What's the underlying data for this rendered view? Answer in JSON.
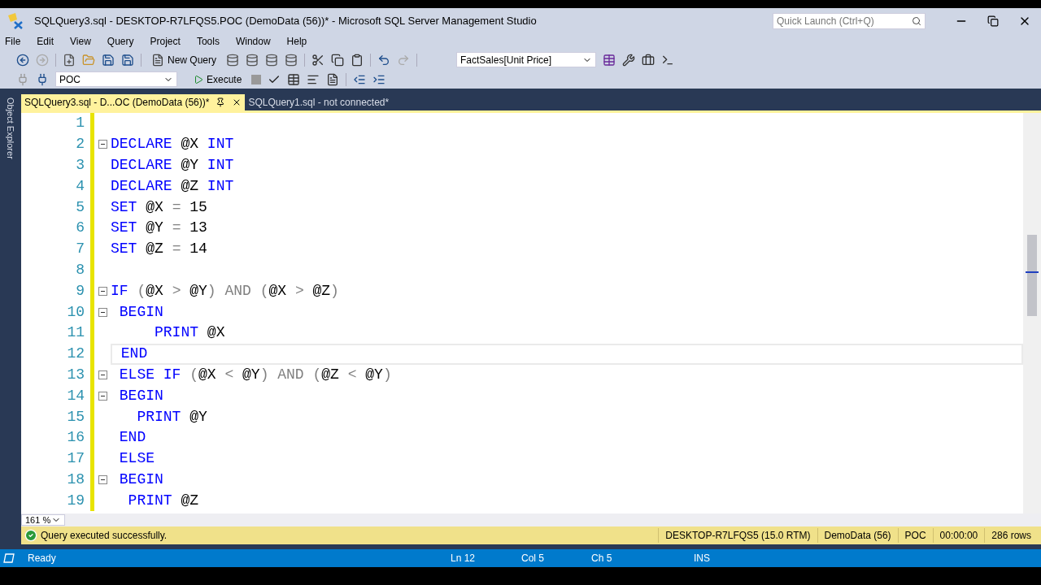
{
  "window": {
    "title": "SQLQuery3.sql - DESKTOP-R7LFQS5.POC (DemoData (56))* - Microsoft SQL Server Management Studio"
  },
  "quick_launch": {
    "placeholder": "Quick Launch (Ctrl+Q)"
  },
  "menu": [
    "File",
    "Edit",
    "View",
    "Query",
    "Project",
    "Tools",
    "Window",
    "Help"
  ],
  "toolbar": {
    "new_query": "New Query",
    "combo": "FactSales[Unit Price]",
    "database": "POC",
    "execute": "Execute"
  },
  "side_panel": {
    "title": "Object Explorer"
  },
  "tabs": [
    {
      "label": "SQLQuery3.sql - D...OC (DemoData (56))*",
      "selected": true
    },
    {
      "label": "SQLQuery1.sql - not connected*",
      "selected": false
    }
  ],
  "editor": {
    "lines": [
      {
        "number": "1",
        "collapsible": false,
        "current": false
      },
      {
        "number": "2",
        "collapsible": true,
        "current": false,
        "tokens": [
          {
            "kind": "keyword",
            "text": "DECLARE"
          },
          {
            "kind": "plain",
            "text": " @X "
          },
          {
            "kind": "keyword",
            "text": "INT"
          }
        ]
      },
      {
        "number": "3",
        "collapsible": false,
        "current": false,
        "tokens": [
          {
            "kind": "keyword",
            "text": "DECLARE"
          },
          {
            "kind": "plain",
            "text": " @Y "
          },
          {
            "kind": "keyword",
            "text": "INT"
          }
        ]
      },
      {
        "number": "4",
        "collapsible": false,
        "current": false,
        "tokens": [
          {
            "kind": "keyword",
            "text": "DECLARE"
          },
          {
            "kind": "plain",
            "text": " @Z "
          },
          {
            "kind": "keyword",
            "text": "INT"
          }
        ]
      },
      {
        "number": "5",
        "collapsible": false,
        "current": false,
        "tokens": [
          {
            "kind": "keyword",
            "text": "SET"
          },
          {
            "kind": "plain",
            "text": " @X "
          },
          {
            "kind": "operator",
            "text": "="
          },
          {
            "kind": "plain",
            "text": " 15"
          }
        ]
      },
      {
        "number": "6",
        "collapsible": false,
        "current": false,
        "tokens": [
          {
            "kind": "keyword",
            "text": "SET"
          },
          {
            "kind": "plain",
            "text": " @Y "
          },
          {
            "kind": "operator",
            "text": "="
          },
          {
            "kind": "plain",
            "text": " 13"
          }
        ]
      },
      {
        "number": "7",
        "collapsible": false,
        "current": false,
        "tokens": [
          {
            "kind": "keyword",
            "text": "SET"
          },
          {
            "kind": "plain",
            "text": " @Z "
          },
          {
            "kind": "operator",
            "text": "="
          },
          {
            "kind": "plain",
            "text": " 14"
          }
        ]
      },
      {
        "number": "8",
        "collapsible": false,
        "current": false
      },
      {
        "number": "9",
        "collapsible": true,
        "current": false,
        "tokens": [
          {
            "kind": "keyword",
            "text": "IF"
          },
          {
            "kind": "operator",
            "text": " ("
          },
          {
            "kind": "plain",
            "text": "@X "
          },
          {
            "kind": "operator",
            "text": ">"
          },
          {
            "kind": "plain",
            "text": " @Y"
          },
          {
            "kind": "operator",
            "text": ") AND ("
          },
          {
            "kind": "plain",
            "text": "@X "
          },
          {
            "kind": "operator",
            "text": ">"
          },
          {
            "kind": "plain",
            "text": " @Z"
          },
          {
            "kind": "operator",
            "text": ")"
          }
        ]
      },
      {
        "number": "10",
        "collapsible": true,
        "current": false,
        "tokens": [
          {
            "kind": "keyword",
            "text": " BEGIN"
          }
        ]
      },
      {
        "number": "11",
        "collapsible": false,
        "current": false,
        "tokens": [
          {
            "kind": "keyword",
            "text": "     PRINT"
          },
          {
            "kind": "plain",
            "text": " @X"
          }
        ]
      },
      {
        "number": "12",
        "collapsible": false,
        "current": true,
        "tokens": [
          {
            "kind": "keyword",
            "text": " END"
          }
        ]
      },
      {
        "number": "13",
        "collapsible": true,
        "current": false,
        "tokens": [
          {
            "kind": "keyword",
            "text": " ELSE IF"
          },
          {
            "kind": "operator",
            "text": " ("
          },
          {
            "kind": "plain",
            "text": "@X "
          },
          {
            "kind": "operator",
            "text": "<"
          },
          {
            "kind": "plain",
            "text": " @Y"
          },
          {
            "kind": "operator",
            "text": ") AND ("
          },
          {
            "kind": "plain",
            "text": "@Z "
          },
          {
            "kind": "operator",
            "text": "<"
          },
          {
            "kind": "plain",
            "text": " @Y"
          },
          {
            "kind": "operator",
            "text": ")"
          }
        ]
      },
      {
        "number": "14",
        "collapsible": true,
        "current": false,
        "tokens": [
          {
            "kind": "keyword",
            "text": " BEGIN"
          }
        ]
      },
      {
        "number": "15",
        "collapsible": false,
        "current": false,
        "tokens": [
          {
            "kind": "keyword",
            "text": "   PRINT"
          },
          {
            "kind": "plain",
            "text": " @Y"
          }
        ]
      },
      {
        "number": "16",
        "collapsible": false,
        "current": false,
        "tokens": [
          {
            "kind": "keyword",
            "text": " END"
          }
        ]
      },
      {
        "number": "17",
        "collapsible": false,
        "current": false,
        "tokens": [
          {
            "kind": "keyword",
            "text": " ELSE"
          }
        ]
      },
      {
        "number": "18",
        "collapsible": true,
        "current": false,
        "tokens": [
          {
            "kind": "keyword",
            "text": " BEGIN"
          }
        ]
      },
      {
        "number": "19",
        "collapsible": false,
        "current": false,
        "tokens": [
          {
            "kind": "keyword",
            "text": "  PRINT"
          },
          {
            "kind": "plain",
            "text": " @Z"
          }
        ]
      }
    ],
    "zoom": "161 %"
  },
  "query_status": {
    "message": "Query executed successfully.",
    "fields": [
      "DESKTOP-R7LFQS5 (15.0 RTM)",
      "DemoData (56)",
      "POC",
      "00:00:00",
      "286 rows"
    ]
  },
  "status_bar": {
    "state": "Ready",
    "line": "Ln 12",
    "column": "Col 5",
    "char": "Ch 5",
    "mode": "INS"
  }
}
